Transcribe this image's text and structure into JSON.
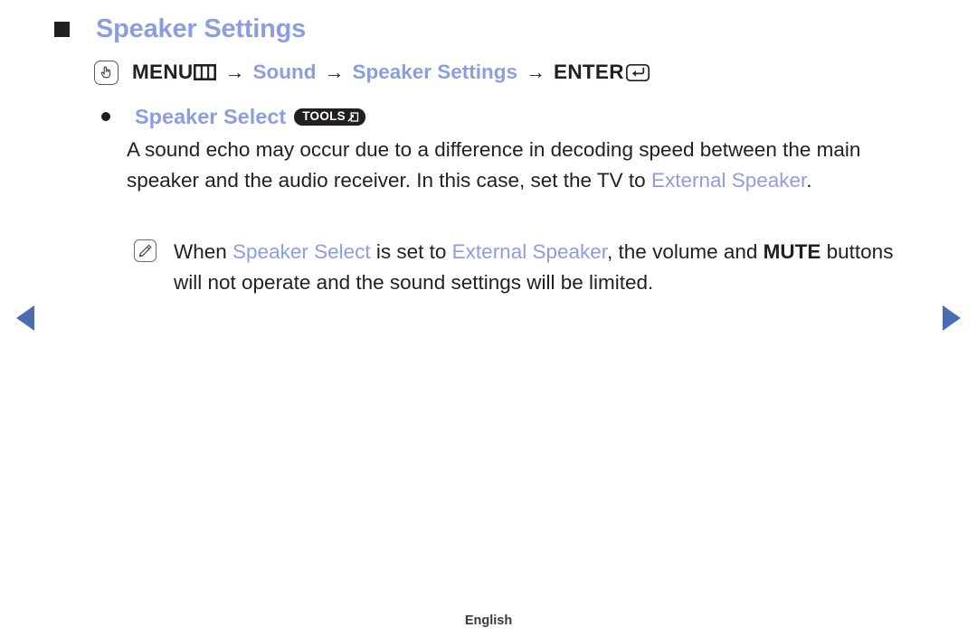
{
  "colors": {
    "accent_blue": "#8d9ee0",
    "arrow_blue": "#4a6cb0",
    "ink": "#231f20",
    "badge_bg": "#231f20",
    "badge_text": "#ffffff",
    "page_bg": "#ffffff"
  },
  "heading": {
    "bullet_icon": "filled-square-icon",
    "title": "Speaker Settings"
  },
  "menu_path": {
    "press_icon": "press-button-hand-icon",
    "menu_label": "MENU",
    "menu_icon": "menu-bars-icon",
    "separator": "→",
    "step_sound": "Sound",
    "step_speaker_settings": "Speaker Settings",
    "enter_label": "ENTER",
    "enter_icon": "enter-return-icon"
  },
  "bullet_item": {
    "dot_icon": "filled-dot-icon",
    "label": "Speaker Select",
    "badge_label": "TOOLS",
    "badge_icon": "tools-popup-icon"
  },
  "paragraph": {
    "part1": "A sound echo may occur due to a difference in decoding speed between the main speaker and the audio receiver. In this case, set the TV to ",
    "highlight": "External Speaker",
    "part2": "."
  },
  "note": {
    "icon": "note-pencil-icon",
    "part1": "When ",
    "highlight1": "Speaker Select",
    "part2": " is set to ",
    "highlight2": "External Speaker",
    "part3": ", the volume and ",
    "emphasis": "MUTE",
    "part4": " buttons will not operate and the sound settings will be limited."
  },
  "navigation": {
    "prev_label": "previous-page-arrow",
    "next_label": "next-page-arrow"
  },
  "footer": {
    "language": "English"
  }
}
